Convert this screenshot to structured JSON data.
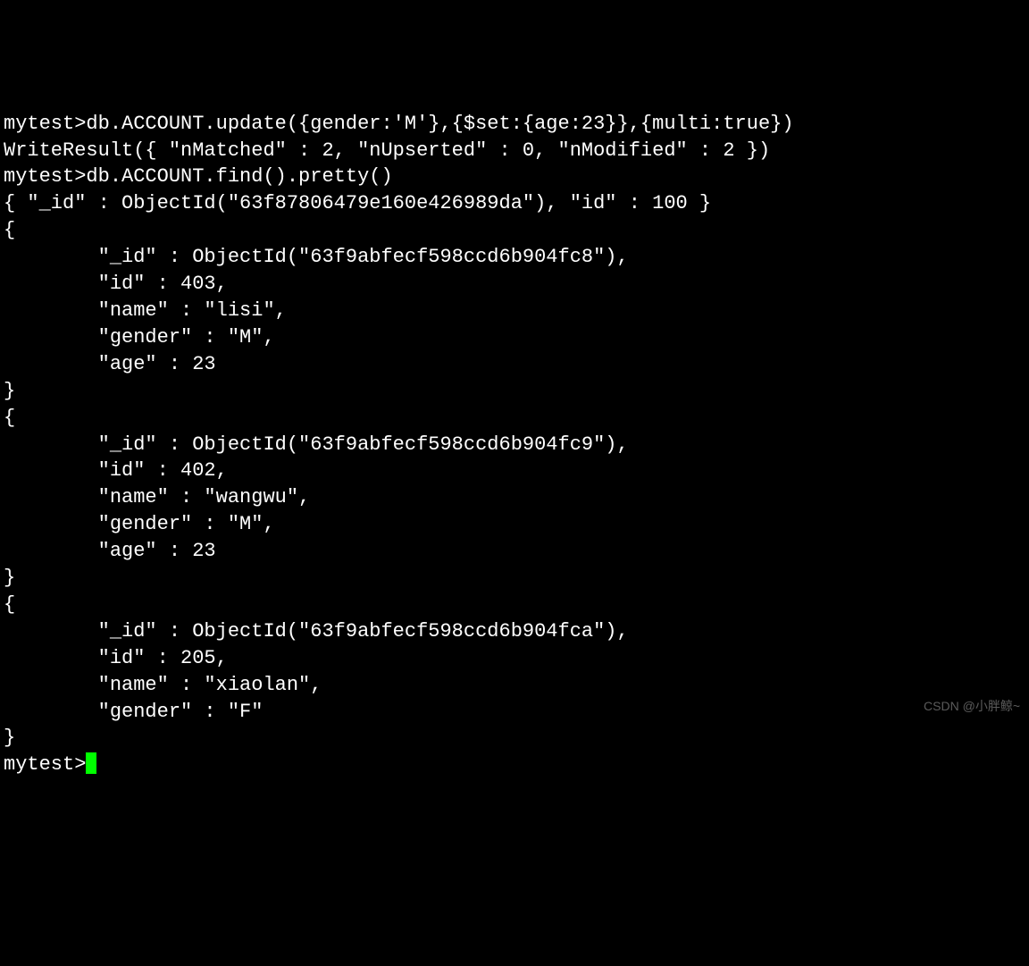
{
  "lines": [
    "mytest>db.ACCOUNT.update({gender:'M'},{$set:{age:23}},{multi:true})",
    "WriteResult({ \"nMatched\" : 2, \"nUpserted\" : 0, \"nModified\" : 2 })",
    "mytest>db.ACCOUNT.find().pretty()",
    "{ \"_id\" : ObjectId(\"63f87806479e160e426989da\"), \"id\" : 100 }",
    "{",
    "        \"_id\" : ObjectId(\"63f9abfecf598ccd6b904fc8\"),",
    "        \"id\" : 403,",
    "        \"name\" : \"lisi\",",
    "        \"gender\" : \"M\",",
    "        \"age\" : 23",
    "}",
    "{",
    "        \"_id\" : ObjectId(\"63f9abfecf598ccd6b904fc9\"),",
    "        \"id\" : 402,",
    "        \"name\" : \"wangwu\",",
    "        \"gender\" : \"M\",",
    "        \"age\" : 23",
    "}",
    "{",
    "        \"_id\" : ObjectId(\"63f9abfecf598ccd6b904fca\"),",
    "        \"id\" : 205,",
    "        \"name\" : \"xiaolan\",",
    "        \"gender\" : \"F\"",
    "}"
  ],
  "prompt": "mytest>",
  "watermark": "CSDN @小胖鲸~"
}
